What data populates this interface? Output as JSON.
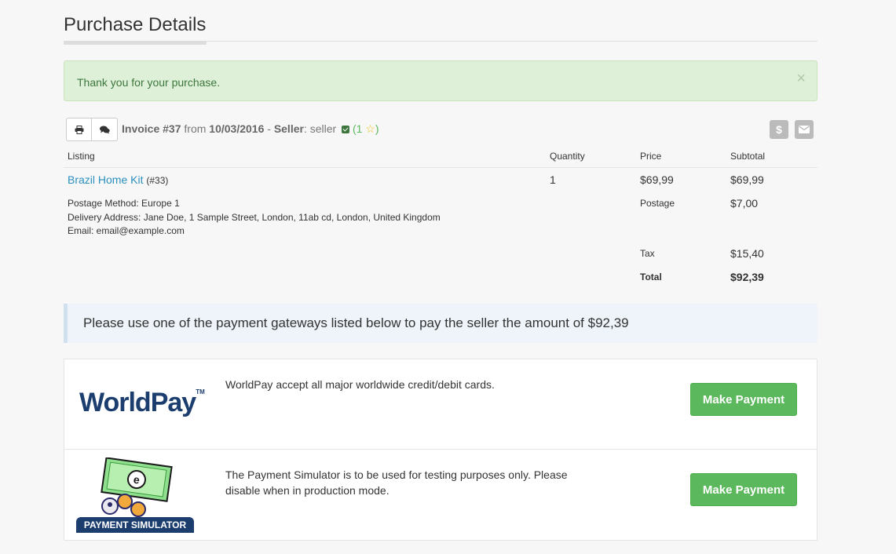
{
  "page": {
    "title": "Purchase Details"
  },
  "alert": {
    "message": "Thank you for your purchase.",
    "close": "×"
  },
  "invoice": {
    "label": "Invoice #37",
    "from_word": "from",
    "date": "10/03/2016",
    "dash": "-",
    "seller_label": "Seller",
    "seller_name": ": seller",
    "rating_open": "(",
    "rating_count": "1",
    "rating_close": ")",
    "star": "☆"
  },
  "actions": {
    "print_icon": "print-icon",
    "comments_icon": "comments-icon",
    "dollar_icon": "$",
    "envelope_icon": "envelope-icon"
  },
  "table": {
    "headers": [
      "Listing",
      "Quantity",
      "Price",
      "Subtotal"
    ],
    "item": {
      "name": "Brazil Home Kit",
      "id": "(#33)",
      "quantity": "1",
      "price": "$69,99",
      "subtotal": "$69,99"
    },
    "postage_method": "Postage Method: Europe 1",
    "delivery_address": "Delivery Address: Jane Doe, 1 Sample Street, London, 11ab cd, London, United Kingdom",
    "email": "Email: email@example.com",
    "postage_label": "Postage",
    "postage_value": "$7,00",
    "tax_label": "Tax",
    "tax_value": "$15,40",
    "total_label": "Total",
    "total_value": "$92,39"
  },
  "payment_info": "Please use one of the payment gateways listed below to pay the seller the amount of $92,39",
  "gateways": [
    {
      "logo_text": "WorldPay",
      "logo_tm": "TM",
      "description": "WorldPay accept all major worldwide credit/debit cards.",
      "button": "Make Payment"
    },
    {
      "logo_text": "PAYMENT SIMULATOR",
      "description": "The Payment Simulator is to be used for testing purposes only. Please disable when in production mode.",
      "button": "Make Payment"
    }
  ],
  "colors": {
    "success_bg": "#dff0d8",
    "success_text": "#3c763d",
    "link": "#2a8fbd",
    "button_green": "#5cb85c",
    "brand_navy": "#1b3e6f"
  }
}
